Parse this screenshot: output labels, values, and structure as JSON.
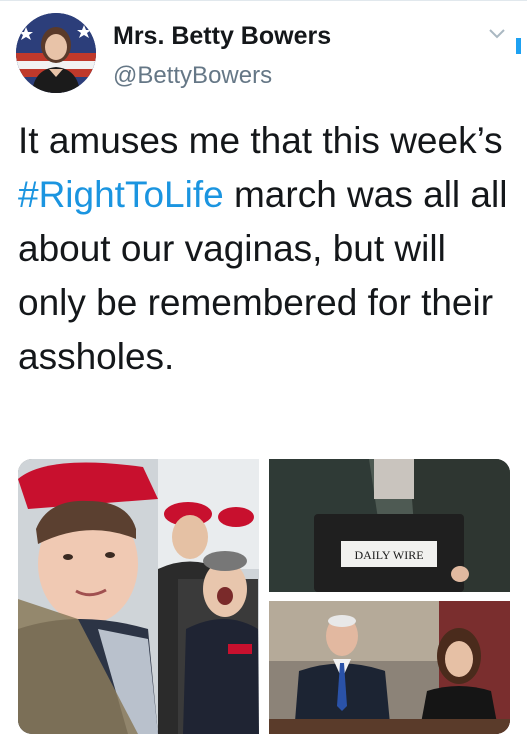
{
  "tweet": {
    "author_name": "Mrs. Betty Bowers",
    "author_handle": "@BettyBowers",
    "text_before": "It amuses me that this week’s ",
    "hashtag": "#RightToLife",
    "text_after": " march was all all about our vaginas, but will only be remembered for their assholes."
  },
  "media": {
    "podium_sign": "DAILY WIRE"
  },
  "icons": {
    "menu": "chevron-down-icon"
  },
  "colors": {
    "link": "#1b95e0",
    "secondary_text": "#657786"
  }
}
